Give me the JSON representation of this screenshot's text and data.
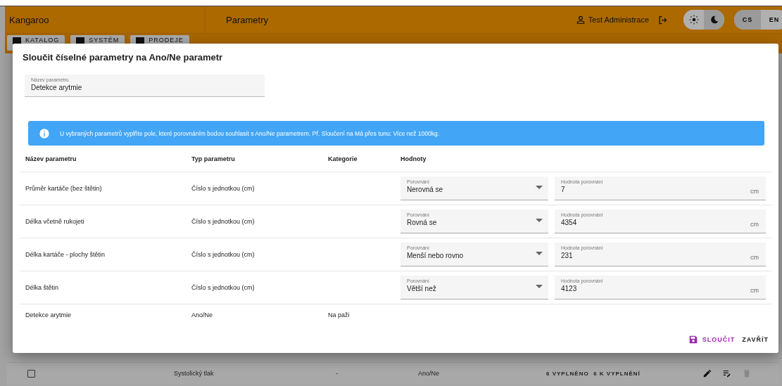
{
  "app_bar": {
    "brand": "Kangaroo",
    "page_title": "Parametry",
    "user": "Test Administrace",
    "theme": [
      {
        "kind": "light",
        "selected": false
      },
      {
        "kind": "dark",
        "selected": true
      }
    ],
    "languages": [
      {
        "label": "CS",
        "selected": true
      },
      {
        "label": "EN",
        "selected": false
      }
    ]
  },
  "nav_tabs": [
    {
      "label": "KATALOG"
    },
    {
      "label": "SYSTÉM"
    },
    {
      "label": "PRODEJE"
    }
  ],
  "background_row": {
    "checked": false,
    "name": "Systolický tlak",
    "category": "-",
    "type": "Ano/Ne",
    "counts": "6 VYPLNĚNO  6 K VYPLNĚNÍ"
  },
  "dialog": {
    "title": "Sloučit číselné parametry na Ano/Ne parametr",
    "name_field": {
      "label": "Název parametru",
      "value": "Detekce arytmie"
    },
    "info": "U vybraných parametrů vyplňte pole, které porovnáním bodou souhlasit s Ano/Ne parametrem. Př. Sloučení na Má přes tunu: Více než 1000kg.",
    "columns": [
      "Název parametru",
      "Typ parametru",
      "Kategorie",
      "Hodnoty"
    ],
    "rows": [
      {
        "name": "Průměr kartáče (bez štětin)",
        "type": "Číslo s jednotkou (cm)",
        "comparison_label": "Porovnání",
        "comparison": "Nerovná se",
        "value_label": "Hodnota porovnání",
        "value": "7",
        "unit": "cm"
      },
      {
        "name": "Délka včetně rukojeti",
        "type": "Číslo s jednotkou (cm)",
        "comparison_label": "Porovnání",
        "comparison": "Rovná se",
        "value_label": "Hodnota porovnání",
        "value": "4354",
        "unit": "cm"
      },
      {
        "name": "Délka kartáče - plochy štětin",
        "type": "Číslo s jednotkou (cm)",
        "comparison_label": "Porovnání",
        "comparison": "Menší nebo rovno",
        "value_label": "Hodnota porovnání",
        "value": "231",
        "unit": "cm"
      },
      {
        "name": "Délka štětin",
        "type": "Číslo s jednotkou (cm)",
        "comparison_label": "Porovnání",
        "comparison": "Větší než",
        "value_label": "Hodnota porovnání",
        "value": "4123",
        "unit": "cm"
      },
      {
        "name": "Detekce arytmie",
        "type": "Ano/Ne",
        "category": "Na paži"
      }
    ],
    "actions": [
      {
        "label": "SLOUČIT",
        "kind": "primary"
      },
      {
        "label": "ZAVŘÍT",
        "kind": "plain"
      }
    ]
  }
}
